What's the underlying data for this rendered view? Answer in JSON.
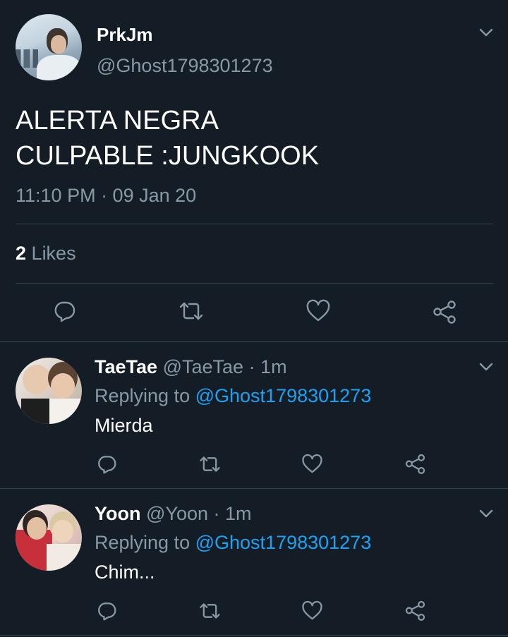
{
  "main_tweet": {
    "display_name": "PrkJm",
    "handle": "@Ghost1798301273",
    "text_line1": "ALERTA NEGRA",
    "text_line2": "CULPABLE :JUNGKOOK",
    "timestamp": "11:10 PM · 09 Jan 20",
    "likes_count": "2",
    "likes_label": "Likes",
    "actions": [
      "reply-icon",
      "retweet-icon",
      "like-icon",
      "share-icon"
    ]
  },
  "replies": [
    {
      "display_name": "TaeTae",
      "handle": "@TaeTae",
      "time": "· 1m",
      "replying_prefix": "Replying to",
      "replying_to": "@Ghost1798301273",
      "text": "Mierda"
    },
    {
      "display_name": "Yoon",
      "handle": "@Yoon",
      "time": "· 1m",
      "replying_prefix": "Replying to",
      "replying_to": "@Ghost1798301273",
      "text": "Chim..."
    }
  ],
  "colors": {
    "background": "#141d26",
    "muted_text": "#8899a6",
    "link": "#1da1f2",
    "divider": "#38444d"
  }
}
